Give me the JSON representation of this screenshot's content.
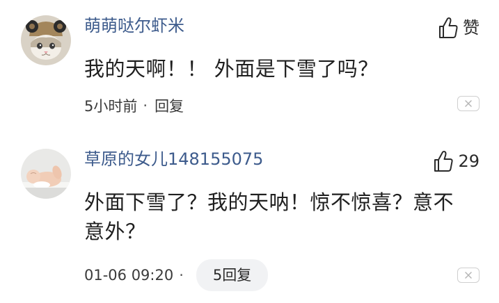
{
  "comments": [
    {
      "username": "萌萌哒尔虾米",
      "content": "我的天啊！！ 外面是下雪了吗？",
      "like_label": "赞",
      "time": "5小时前",
      "dot": "·",
      "reply_label": "回复",
      "avatar_icon": "cat-with-hat-avatar"
    },
    {
      "username": "草原的女儿148155075",
      "content": "外面下雪了？我的天呐！惊不惊喜？意不意外？",
      "like_count": "29",
      "time": "01-06 09:20",
      "dot": "·",
      "reply_label": "5回复",
      "avatar_icon": "baby-avatar"
    }
  ],
  "colors": {
    "username": "#3d5b8c",
    "text": "#1f1f1f",
    "pill_bg": "#f1f2f4"
  }
}
